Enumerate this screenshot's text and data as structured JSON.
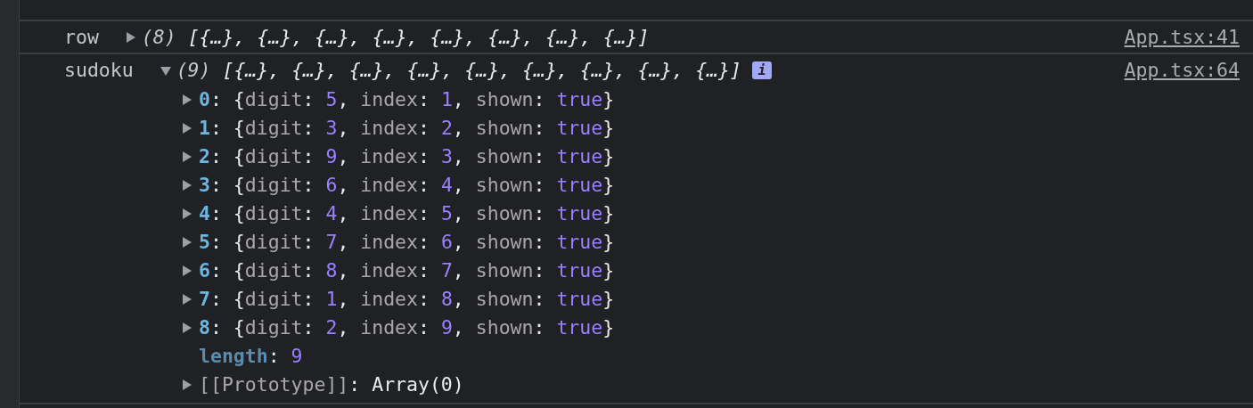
{
  "entries": [
    {
      "label": "row",
      "expanded": false,
      "count": "(8)",
      "preview": "[{…}, {…}, {…}, {…}, {…}, {…}, {…}, {…}]",
      "source": "App.tsx:41"
    },
    {
      "label": "sudoku",
      "expanded": true,
      "count": "(9)",
      "preview": "[{…}, {…}, {…}, {…}, {…}, {…}, {…}, {…}, {…}]",
      "info_badge": "i",
      "source": "App.tsx:64",
      "children": [
        {
          "key": "0:",
          "value": "{digit: 5, index: 1, shown: true}",
          "expanded": false
        },
        {
          "key": "1:",
          "value": "{digit: 3, index: 2, shown: true}",
          "expanded": false
        },
        {
          "key": "2:",
          "value": "{digit: 9, index: 3, shown: true}",
          "expanded": false
        },
        {
          "key": "3:",
          "value": "{digit: 6, index: 4, shown: true}",
          "expanded": false
        },
        {
          "key": "4:",
          "value": "{digit: 4, index: 5, shown: true}",
          "expanded": false
        },
        {
          "key": "5:",
          "value": "{digit: 7, index: 6, shown: true}",
          "expanded": false
        },
        {
          "key": "6:",
          "value": "{digit: 8, index: 7, shown: true}",
          "expanded": false
        },
        {
          "key": "7:",
          "value": "{digit: 1, index: 8, shown: true}",
          "expanded": false
        },
        {
          "key": "8:",
          "value": "{digit: 2, index: 9, shown: true}",
          "expanded": false
        }
      ],
      "length": {
        "key": "length:",
        "value": "9"
      },
      "prototype": {
        "key": "[[Prototype]]:",
        "value": "Array(0)",
        "expanded": false
      }
    }
  ]
}
